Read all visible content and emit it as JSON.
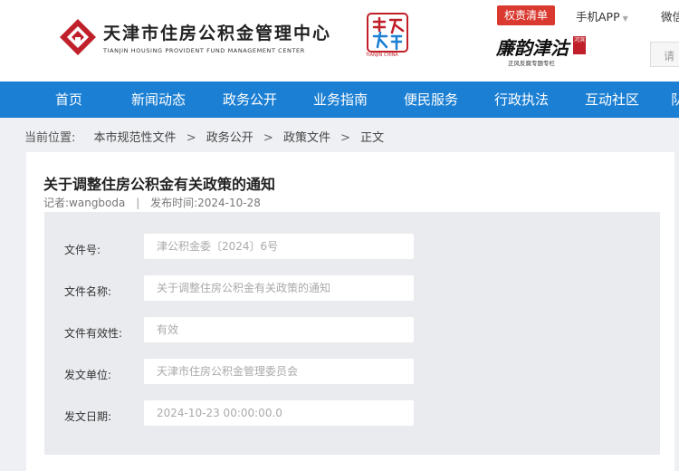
{
  "header": {
    "logo_cn": "天津市住房公积金管理中心",
    "logo_en": "TIANJIN HOUSING PROVIDENT FUND MANAGEMENT CENTER",
    "seal_caption": "TIANJIN CHINA",
    "power_list_label": "权责清单",
    "app_label": "手机APP",
    "wechat_label": "微信",
    "calligraphy": "廉韵津沽",
    "calligraphy_tag": "河滨",
    "calligraphy_sub": "正风反腐专题专栏",
    "search_placeholder": "请"
  },
  "nav": {
    "items": [
      "首页",
      "新闻动态",
      "政务公开",
      "业务指南",
      "便民服务",
      "行政执法",
      "互动社区",
      "队"
    ]
  },
  "breadcrumb": {
    "label": "当前位置:",
    "items": [
      "本市规范性文件",
      "政务公开",
      "政策文件",
      "正文"
    ],
    "separator": ">"
  },
  "article": {
    "title": "关于调整住房公积金有关政策的通知",
    "author_label": "记者:wangboda",
    "divider": "|",
    "date_label": "发布时间:2024-10-28",
    "fields": [
      {
        "label": "文件号:",
        "value": "津公积金委〔2024〕6号"
      },
      {
        "label": "文件名称:",
        "value": "关于调整住房公积金有关政策的通知"
      },
      {
        "label": "文件有效性:",
        "value": "有效"
      },
      {
        "label": "发文单位:",
        "value": "天津市住房公积金管理委员会"
      },
      {
        "label": "发文日期:",
        "value": "2024-10-23 00:00:00.0"
      }
    ]
  },
  "colors": {
    "nav_blue": "#1b7fd3",
    "accent_red": "#d9392f",
    "logo_red": "#c0202a"
  }
}
